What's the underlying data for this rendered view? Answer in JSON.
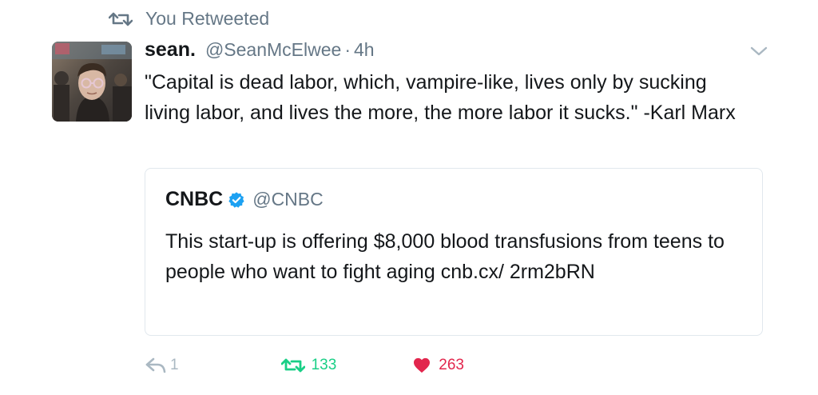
{
  "context": {
    "label": "You Retweeted",
    "icon": "retweet-icon"
  },
  "author": {
    "name": "sean.",
    "handle": "@SeanMcElwee",
    "separator": "·",
    "time": "4h"
  },
  "tweet_text": "\"Capital is dead labor, which, vampire-like, lives only by sucking living labor, and lives the more, the more labor it sucks.\" -Karl Marx",
  "quoted": {
    "name": "CNBC",
    "handle": "@CNBC",
    "verified": true,
    "text": "This start-up is offering $8,000 blood transfusions from teens to people who want to fight aging  cnb.cx/ 2rm2bRN"
  },
  "actions": {
    "reply_count": "1",
    "retweet_count": "133",
    "like_count": "263"
  },
  "colors": {
    "text": "#14171a",
    "muted": "#657786",
    "retweet_active": "#19cf86",
    "like_active": "#e2264d",
    "verified": "#1da1f2",
    "border": "#e1e8ed"
  }
}
